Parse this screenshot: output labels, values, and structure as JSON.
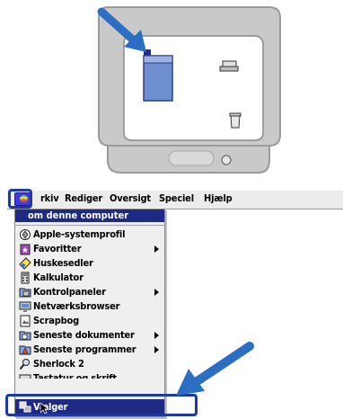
{
  "menubar": {
    "items": [
      "Arkiv",
      "Rediger",
      "Oversigt",
      "Speciel",
      "Hjælp"
    ],
    "visible_texts": [
      "rkiv",
      "Rediger",
      "Oversigt",
      "Speciel",
      "Hjælp"
    ]
  },
  "apple_menu": {
    "header": "Om denne computer",
    "header_visible": "om denne computer",
    "items": [
      {
        "label": "Apple-systemprofil",
        "icon": "profile-icon",
        "submenu": false
      },
      {
        "label": "Favoritter",
        "icon": "favorites-icon",
        "submenu": true
      },
      {
        "label": "Huskesedler",
        "icon": "notes-icon",
        "submenu": false
      },
      {
        "label": "Kalkulator",
        "icon": "calculator-icon",
        "submenu": false
      },
      {
        "label": "Kontrolpaneler",
        "icon": "control-panels-icon",
        "submenu": true
      },
      {
        "label": "Netværksbrowser",
        "icon": "network-icon",
        "submenu": false
      },
      {
        "label": "Scrapbog",
        "icon": "scrapbook-icon",
        "submenu": false
      },
      {
        "label": "Seneste dokumenter",
        "icon": "recent-docs-icon",
        "submenu": true
      },
      {
        "label": "Seneste programmer",
        "icon": "recent-apps-icon",
        "submenu": true
      },
      {
        "label": "Sherlock 2",
        "icon": "sherlock-icon",
        "submenu": false
      },
      {
        "label": "Tastatur og skrift",
        "icon": "keyboard-icon",
        "submenu": false
      },
      {
        "label": "Vælger",
        "icon": "chooser-icon",
        "submenu": false,
        "selected": true
      }
    ]
  },
  "colors": {
    "highlight_frame": "#1e3aa0",
    "arrow": "#2b6fc4",
    "selection": "#1f2a84",
    "menu_bg": "#efefef"
  }
}
